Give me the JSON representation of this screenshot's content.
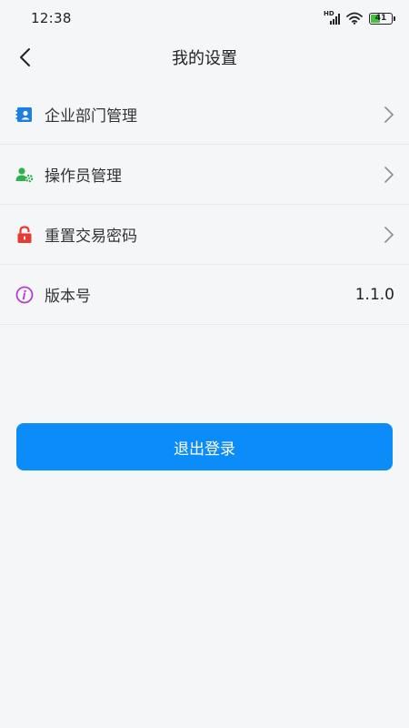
{
  "status_bar": {
    "time": "12:38",
    "network": "HD",
    "battery_level": "41"
  },
  "header": {
    "title": "我的设置"
  },
  "menu": {
    "items": [
      {
        "label": "企业部门管理",
        "icon": "contact-book-icon"
      },
      {
        "label": "操作员管理",
        "icon": "user-gear-icon"
      },
      {
        "label": "重置交易密码",
        "icon": "lock-icon"
      },
      {
        "label": "版本号",
        "icon": "info-icon",
        "value": "1.1.0"
      }
    ]
  },
  "actions": {
    "logout_label": "退出登录"
  },
  "colors": {
    "accent": "#0b8cf8",
    "enterprise_icon": "#1d7fe0",
    "operator_icon": "#2fb24a",
    "lock_icon": "#e53b33",
    "info_icon": "#b33fd1"
  }
}
